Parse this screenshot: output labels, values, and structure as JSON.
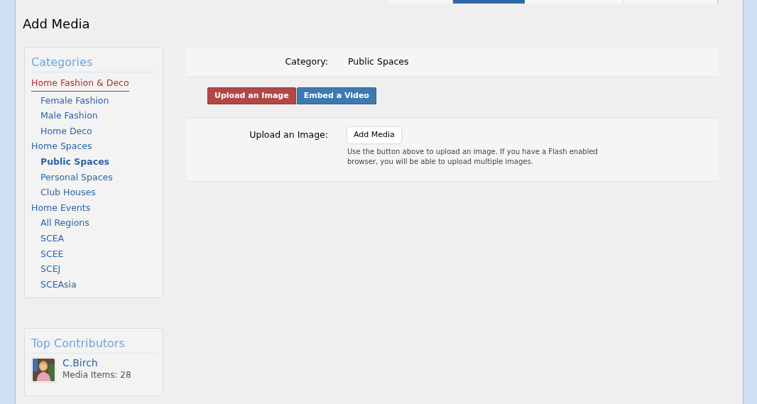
{
  "nav_tabs": [
    {
      "selected": false
    },
    {
      "selected": true
    },
    {
      "selected": false
    },
    {
      "selected": false
    }
  ],
  "page_title": "Add Media",
  "categories": {
    "title": "Categories",
    "items": [
      {
        "label": "Home Fashion & Deco",
        "highlighted": true,
        "selected": false,
        "children": [
          {
            "label": "Female Fashion",
            "highlighted": false,
            "selected": false
          },
          {
            "label": "Male Fashion",
            "highlighted": false,
            "selected": false
          },
          {
            "label": "Home Deco",
            "highlighted": false,
            "selected": false
          }
        ]
      },
      {
        "label": "Home Spaces",
        "highlighted": false,
        "selected": false,
        "children": [
          {
            "label": "Public Spaces",
            "highlighted": false,
            "selected": true
          },
          {
            "label": "Personal Spaces",
            "highlighted": false,
            "selected": false
          },
          {
            "label": "Club Houses",
            "highlighted": false,
            "selected": false
          }
        ]
      },
      {
        "label": "Home Events",
        "highlighted": false,
        "selected": false,
        "children": [
          {
            "label": "All Regions",
            "highlighted": false,
            "selected": false
          },
          {
            "label": "SCEA",
            "highlighted": false,
            "selected": false
          },
          {
            "label": "SCEE",
            "highlighted": false,
            "selected": false
          },
          {
            "label": "SCEJ",
            "highlighted": false,
            "selected": false
          },
          {
            "label": "SCEAsia",
            "highlighted": false,
            "selected": false
          }
        ]
      }
    ]
  },
  "top_contributors": {
    "title": "Top Contributors",
    "items": [
      {
        "name": "C.Birch",
        "detail": "Media Items: 28"
      }
    ]
  },
  "category_row": {
    "label": "Category:",
    "value": "Public Spaces"
  },
  "media_tabs": [
    {
      "label": "Upload an Image",
      "selected": true
    },
    {
      "label": "Embed a Video",
      "selected": false
    }
  ],
  "upload_row": {
    "label": "Upload an Image:",
    "button": "Add Media",
    "hint": "Use the button above to upload an image. If you have a Flash enabled browser, you will be able to upload multiple images."
  }
}
